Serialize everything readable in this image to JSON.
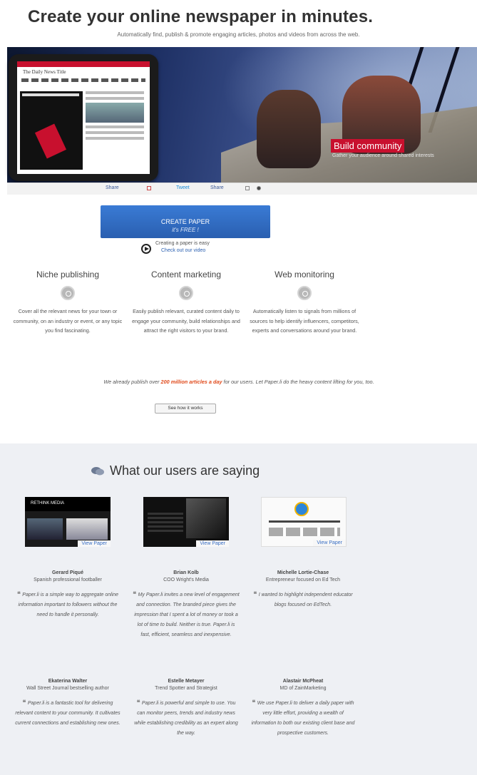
{
  "hero": {
    "title": "Create your online newspaper in minutes.",
    "subtitle": "Automatically find, publish & promote engaging articles, photos and videos from across the web."
  },
  "banner": {
    "headline": "Build community",
    "sub": "Gather your audience around shared interests",
    "tablet_title": "The Daily News Title"
  },
  "share": {
    "items": [
      "Share",
      "Tweet",
      "Share"
    ]
  },
  "cta": {
    "label": "CREATE PAPER",
    "sub": "it's FREE !"
  },
  "video": {
    "line1": "Creating a paper is easy",
    "link": "Check out our video"
  },
  "features": [
    {
      "title": "Niche publishing",
      "icon": "niche-icon",
      "desc": "Cover all the relevant news for your town or community, on an industry or event, or any topic you find fascinating."
    },
    {
      "title": "Content marketing",
      "icon": "lightbulb-icon",
      "desc": "Easily publish relevant, curated content daily to engage your community, build relationships and attract the right visitors to your brand."
    },
    {
      "title": "Web monitoring",
      "icon": "monitor-icon",
      "desc": "Automatically listen to signals from millions of sources to help identify influencers, competitors, experts and conversations around your brand."
    }
  ],
  "stats": {
    "prefix": "We already publish over ",
    "highlight": "200 million articles a day",
    "suffix": " for our users. Let Paper.li do the heavy content lifting for you, too."
  },
  "how_button": "See how it works",
  "testimonials": {
    "heading": "What our users are saying",
    "view_label": "View Paper",
    "thumb_header": "RETHINK MEDIA",
    "people": [
      {
        "name": "Gerard Piqué",
        "role": "Spanish professional footballer",
        "quote": "Paper.li is a simple way to aggregate online information important to followers without the need to handle it personally."
      },
      {
        "name": "Brian Kolb",
        "role": "COO Wright's Media",
        "quote": "My Paper.li invites a new level of engagement and connection. The branded piece gives the impression that I spent a lot of money or took a lot of time to build. Neither is true. Paper.li is fast, efficient, seamless and inexpensive."
      },
      {
        "name": "Michelle Lortie-Chase",
        "role": "Entrepreneur focused on Ed Tech",
        "quote": "I wanted to highlight independent educator blogs focused on EdTech."
      },
      {
        "name": "Ekaterina Walter",
        "role": "Wall Street Journal bestselling author",
        "quote": "Paper.li is a fantastic tool for delivering relevant content to your community. It cultivates current connections and establishing new ones."
      },
      {
        "name": "Estelle Metayer",
        "role": "Trend Spotter and Strategist",
        "quote": "Paper.li is powerful and simple to use. You can monitor peers, trends and industry news while establishing credibility as an expert along the way."
      },
      {
        "name": "Alastair McPheat",
        "role": "MD of ZainMarketing",
        "quote": "We use Paper.li to deliver a daily paper with very little effort, providing a wealth of information to both our existing client base and prospective customers."
      }
    ]
  }
}
